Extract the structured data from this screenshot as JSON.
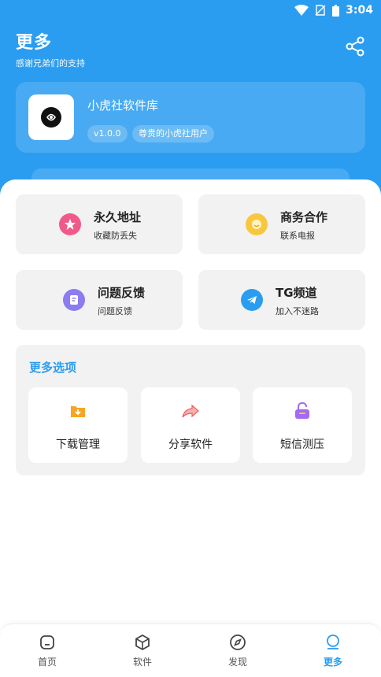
{
  "status_bar": {
    "time": "3:04"
  },
  "header": {
    "title": "更多",
    "subtitle": "感谢兄弟们的支持"
  },
  "app_card": {
    "name": "小虎社软件库",
    "version": "v1.0.0",
    "user_badge": "尊贵的小虎社用户"
  },
  "tiles": [
    {
      "title": "永久地址",
      "subtitle": "收藏防丢失",
      "icon": "star-icon"
    },
    {
      "title": "商务合作",
      "subtitle": "联系电报",
      "icon": "chat-bubble-icon"
    },
    {
      "title": "问题反馈",
      "subtitle": "问题反馈",
      "icon": "feedback-icon"
    },
    {
      "title": "TG频道",
      "subtitle": "加入不迷路",
      "icon": "telegram-icon"
    }
  ],
  "more_options": {
    "title": "更多选项",
    "items": [
      {
        "label": "下载管理",
        "icon": "download-folder-icon"
      },
      {
        "label": "分享软件",
        "icon": "share-arrow-icon"
      },
      {
        "label": "短信测压",
        "icon": "lock-icon"
      }
    ]
  },
  "tabbar": {
    "items": [
      {
        "label": "首页",
        "icon": "home-icon"
      },
      {
        "label": "软件",
        "icon": "cube-icon"
      },
      {
        "label": "发现",
        "icon": "compass-icon"
      },
      {
        "label": "更多",
        "icon": "profile-icon"
      }
    ],
    "active": "更多"
  },
  "colors": {
    "primary": "#2b9df0",
    "tile_bg": "#f2f2f2",
    "star": "#ef5a8a",
    "chat": "#f7c83e",
    "feedback": "#8b7cf0",
    "telegram": "#2b9df0",
    "download": "#f6a623",
    "share": "#f07b7b",
    "lock": "#a36cf0"
  }
}
